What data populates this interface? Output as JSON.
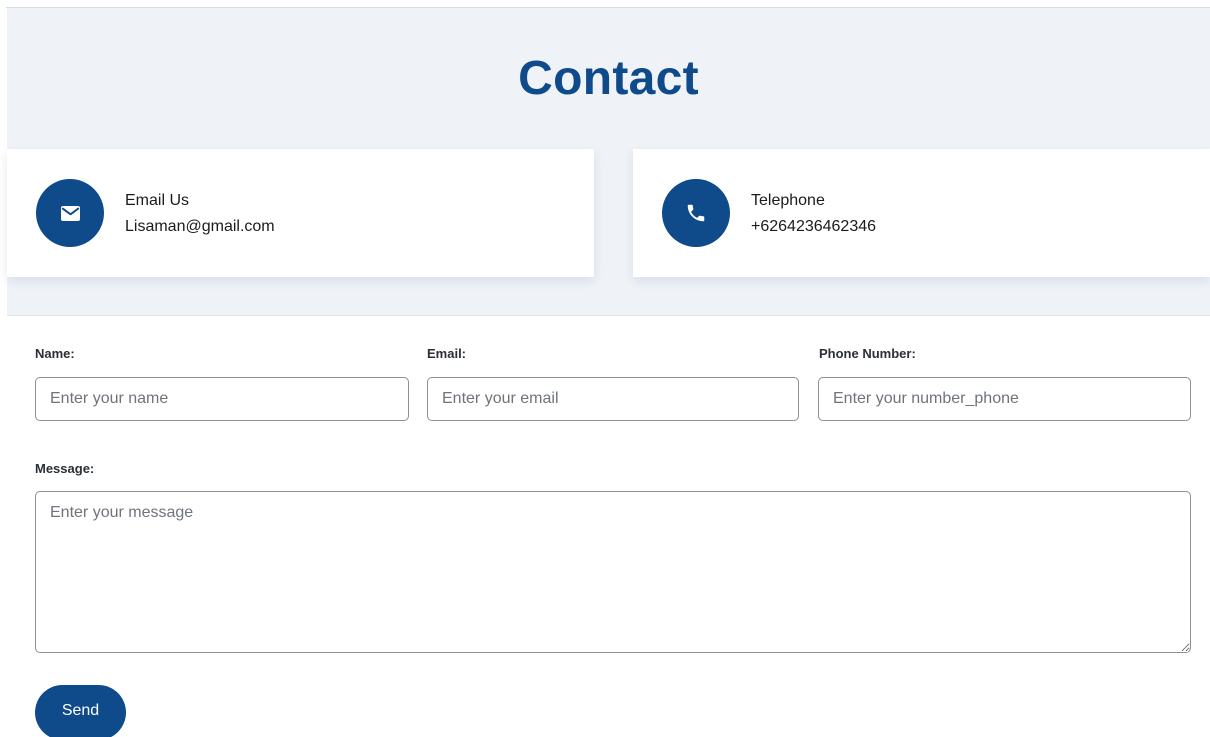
{
  "header": {
    "title": "Contact"
  },
  "cards": {
    "email": {
      "icon": "envelope-icon",
      "label": "Email Us",
      "value": "Lisaman@gmail.com"
    },
    "phone": {
      "icon": "phone-icon",
      "label": "Telephone",
      "value": "+6264236462346"
    }
  },
  "form": {
    "name": {
      "label": "Name:",
      "placeholder": "Enter your name",
      "value": ""
    },
    "email": {
      "label": "Email:",
      "placeholder": "Enter your email",
      "value": ""
    },
    "phone": {
      "label": "Phone Number:",
      "placeholder": "Enter your number_phone",
      "value": ""
    },
    "message": {
      "label": "Message:",
      "placeholder": "Enter your message",
      "value": ""
    },
    "send_label": "Send"
  },
  "colors": {
    "accent": "#0f4a8a",
    "section_background": "#eff3f8",
    "card_background": "#ffffff"
  }
}
